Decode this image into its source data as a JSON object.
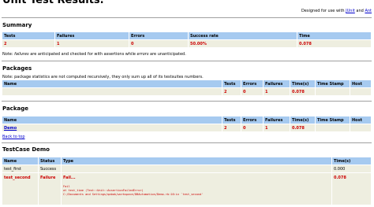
{
  "header": {
    "title": "Unit Test Results.",
    "designed_prefix": "Designed for use with",
    "junit_link": "JUnit",
    "and": "and",
    "ant_link": "Ant"
  },
  "summary": {
    "heading": "Summary",
    "columns": [
      "Tests",
      "Failures",
      "Errors",
      "Success rate",
      "Time"
    ],
    "row": [
      "2",
      "1",
      "0",
      "50.00%",
      "0.078"
    ],
    "note_pre": "Note: ",
    "note_failures": "failures",
    "note_mid": " are anticipated and checked for with assertions while ",
    "note_errors": "errors",
    "note_post": " are unanticipated."
  },
  "packages": {
    "heading": "Packages",
    "note": "Note: package statistics are not computed recursively, they only sum up all of its testsuites numbers.",
    "columns": [
      "Name",
      "Tests",
      "Errors",
      "Failures",
      "Time(s)",
      "Time Stamp",
      "Host"
    ],
    "row": [
      "",
      "2",
      "0",
      "1",
      "0.078",
      "",
      ""
    ]
  },
  "package": {
    "heading": "Package",
    "columns": [
      "Name",
      "Tests",
      "Errors",
      "Failures",
      "Time(s)",
      "Time Stamp",
      "Host"
    ],
    "row": [
      "Demo",
      "2",
      "0",
      "1",
      "0.078",
      "",
      ""
    ],
    "back_to_top": "Back to top"
  },
  "testcase": {
    "heading": "TestCase Demo",
    "columns": [
      "Name",
      "Status",
      "Type",
      "Time(s)"
    ],
    "rows": [
      {
        "name": "test_first",
        "status": "Success",
        "type": "",
        "time": "0.000"
      },
      {
        "name": "test_second",
        "status": "Failure",
        "type": "Fail...",
        "time": "0.078"
      }
    ],
    "trace": [
      "Fail",
      "  at test_time  (Test::Unit::AssertionFailedError)",
      "  C:/Documents and Settings/qabak/workspace/DBAutomation/Demo.rb:16:in `test_second'"
    ]
  },
  "colors": {
    "header_bg": "#a6caf0",
    "cell_bg": "#eeeee0",
    "failure": "#cc0000",
    "link": "#0000cc"
  }
}
